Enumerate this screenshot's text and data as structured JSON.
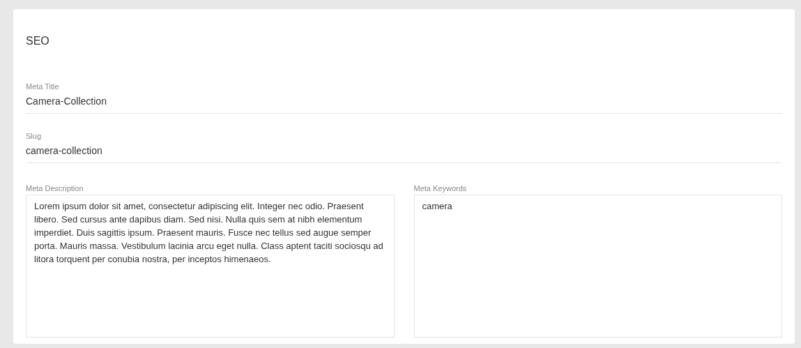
{
  "section_title": "SEO",
  "fields": [
    {
      "kind": "line",
      "label": "Meta Title",
      "value": "Camera-Collection"
    },
    {
      "kind": "line",
      "label": "Slug",
      "value": "camera-collection"
    }
  ],
  "text_areas": [
    {
      "label": "Meta Description",
      "value": "Lorem ipsum dolor sit amet, consectetur adipiscing elit. Integer nec odio. Praesent libero. Sed cursus ante dapibus diam. Sed nisi. Nulla quis sem at nibh elementum imperdiet. Duis sagittis ipsum. Praesent mauris. Fusce nec tellus sed augue semper porta. Mauris massa. Vestibulum lacinia arcu eget nulla. Class aptent taciti sociosqu ad litora torquent per conubia nostra, per inceptos himenaeos."
    },
    {
      "label": "Meta Keywords",
      "value": "camera"
    }
  ]
}
